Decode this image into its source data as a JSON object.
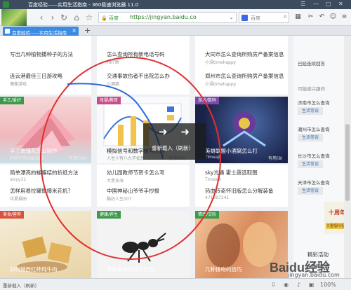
{
  "window": {
    "title": "百度经验——实用生活指南 - 360极速浏览器 11.0",
    "controls": [
      "☰",
      "—",
      "▢",
      "✕"
    ]
  },
  "toolbar": {
    "url_secure_label": "百度",
    "url": "https://jingyan.baidu.co",
    "search_placeholder": "百度",
    "icons": [
      "extensions-icon",
      "scissors-icon",
      "undo-icon",
      "smiley-icon",
      "menu-icon"
    ]
  },
  "tab": {
    "title": "百度经验——实用生活指南",
    "close": "×",
    "new": "+"
  },
  "column1": {
    "card_top": {
      "title": "写出几种植物播种子的方法",
      "title2": "连云港最佳三日游攻略",
      "meta2": "偶像游戏"
    },
    "card_mid": {
      "ribbon": "手工/爱好",
      "title": "手工玫瑰花怎么制作",
      "meta": "利用不用的纸张做",
      "link": "有用(34)"
    },
    "below_mid": [
      {
        "title": "简单漂亮的蝴蝶结的折纸方法",
        "meta": "sixyy11"
      },
      {
        "title": "怎样用易拉罐做爆米花机?",
        "meta": "华夏福田"
      }
    ],
    "card_bottom": {
      "ribbon": "美食/营养",
      "title": "如何做西红柿炖牛肉"
    }
  },
  "column2": {
    "card_top": {
      "title": "怎么查询所有新电话号码",
      "meta": "HIIT新",
      "title2": "交通事故伤者不出院怎么办",
      "meta2": "小酒窝"
    },
    "card_mid": {
      "ribbon": "母婴/教育",
      "title": "模拟信号和数字信号区别",
      "meta": "人生十有八九不如意",
      "link": "有用(20)"
    },
    "below_mid": [
      {
        "title": "幼儿园教师节贺卡怎么写",
        "meta": "大青东海"
      },
      {
        "title": "中国神秘山爷爷手抄报",
        "meta": "酷奶人生007"
      }
    ],
    "card_bottom": {
      "ribbon": "健康/养生",
      "title": "黑蚁般的功效与作用"
    }
  },
  "column3": {
    "card_top": {
      "title": "大同市怎么查询所购房产备案信息",
      "meta": "小渦timehappy",
      "title2": "郑州市怎么查询所购房产备案信息",
      "meta2": "小渦timehappy"
    },
    "card_mid": {
      "ribbon": "游戏/数码",
      "title": "英雄联盟小酒窝怎么打",
      "meta": "Timeajk",
      "link": "有用(8)"
    },
    "below_mid": [
      {
        "title": "sky光遇 霍土霞选取图",
        "meta": "Timeajk"
      },
      {
        "title": "热血传奇怀旧版怎么分解装备",
        "meta": "471997241"
      }
    ],
    "card_bottom": {
      "ribbon": "情感/交际",
      "title": "几种接吻的技巧"
    }
  },
  "sidebar": {
    "top_label": "已经连续回答",
    "section_title": "可能感兴趣的",
    "items": [
      {
        "label": "济南市怎么查询",
        "button": "生活常谈"
      },
      {
        "label": "潮州市怎么查询",
        "button": "生活常谈"
      },
      {
        "label": "长沙市怎么查询",
        "button": "生活常谈"
      },
      {
        "label": "天津市怎么查询",
        "button": "生活常谈"
      }
    ]
  },
  "promo": {
    "title": "十周年",
    "sub": "三重福利活动"
  },
  "activity": {
    "title": "精彩活动",
    "sub": "百度知道"
  },
  "watermark": {
    "text": "Baidu经验",
    "sub": "jingyan.baidu.com"
  },
  "overlay": {
    "arrows": "➜ ➜",
    "label": "重新载入（刷新）"
  },
  "status": {
    "text": "重新载入（刷新）",
    "zoom": "100%"
  }
}
